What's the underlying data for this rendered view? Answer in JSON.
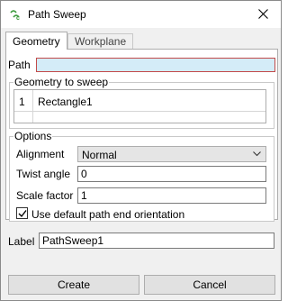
{
  "window": {
    "title": "Path Sweep",
    "app_icon": "sweep-app-icon",
    "close_icon": "close-icon"
  },
  "tabs": [
    {
      "label": "Geometry",
      "active": true
    },
    {
      "label": "Workplane",
      "active": false
    }
  ],
  "path": {
    "label": "Path",
    "value": ""
  },
  "geometry_to_sweep": {
    "title": "Geometry to sweep",
    "items": [
      {
        "index": "1",
        "name": "Rectangle1"
      }
    ]
  },
  "options": {
    "title": "Options",
    "alignment": {
      "label": "Alignment",
      "value": "Normal"
    },
    "twist_angle": {
      "label": "Twist angle",
      "value": "0"
    },
    "scale_factor": {
      "label": "Scale factor",
      "value": "1"
    },
    "default_path_end": {
      "label": "Use default path end orientation",
      "checked": true
    }
  },
  "label_field": {
    "label": "Label",
    "value": "PathSweep1"
  },
  "buttons": {
    "create": "Create",
    "cancel": "Cancel"
  },
  "colors": {
    "path_highlight": "#d4ecf8",
    "path_error_border": "#c24a4a",
    "app_icon_green": "#3a9a3a"
  }
}
